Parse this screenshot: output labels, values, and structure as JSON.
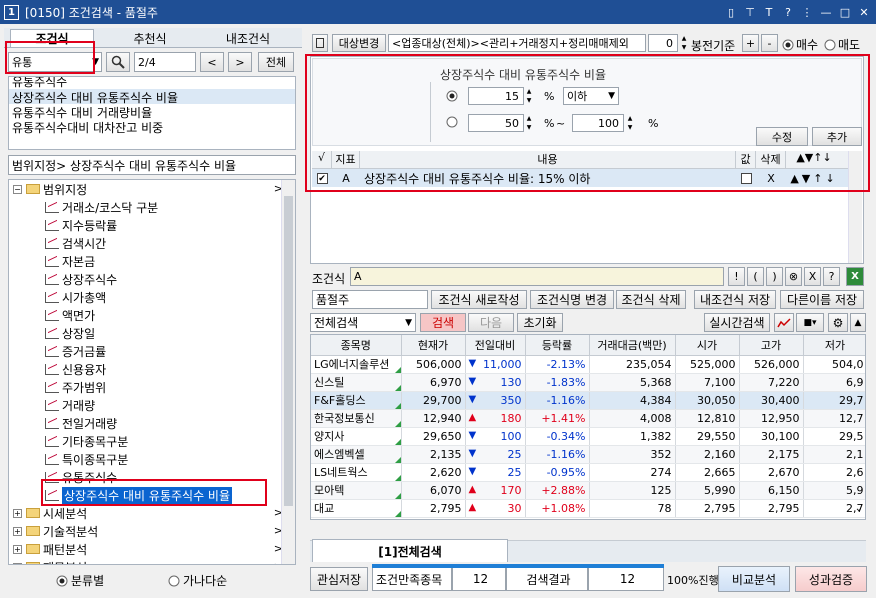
{
  "window": {
    "number_badge": "1",
    "title": "[0150] 조건검색 - 품절주",
    "controls": [
      "▯",
      "⊤",
      "T",
      "?",
      "⋮",
      "—",
      "□",
      "✕"
    ]
  },
  "left": {
    "tabs": [
      "조건식",
      "추천식",
      "내조건식"
    ],
    "search": {
      "value": "유통",
      "page": "2/4",
      "all_label": "전체"
    },
    "results": [
      "유통주식수",
      "상장주식수 대비 유통주식수 비율",
      "유통주식수 대비 거래량비율",
      "유통주식수대비 대차잔고 비중"
    ],
    "path": "범위지정> 상장주식수 대비 유통주식수 비율",
    "tree_root": "범위지정",
    "tree_items": [
      "거래소/코스닥 구분",
      "지수등락률",
      "검색시간",
      "자본금",
      "상장주식수",
      "시가총액",
      "액면가",
      "상장일",
      "증거금률",
      "신용융자",
      "주가범위",
      "거래량",
      "전일거래량",
      "기타종목구분",
      "특이종목구분",
      "유통주식수",
      "상장주식수 대비 유통주식수 비율"
    ],
    "tree_folders": [
      "시세분석",
      "기술적분석",
      "패턴분석",
      "재무분석"
    ],
    "radio_category": "분류별",
    "radio_alpha": "가나다순"
  },
  "top_bar": {
    "target_change": "대상변경",
    "target_value": "<업종대상(전체)><관리+거래정지+정리매매제외",
    "bar_count": "0",
    "bar_label": "봉전기준",
    "plus": "+",
    "minus": "-",
    "buy": "매수",
    "sell": "매도"
  },
  "condition_editor": {
    "title": "상장주식수 대비 유통주식수 비율",
    "opt1": {
      "value": "15",
      "unit": "%",
      "compare": "이하"
    },
    "opt2": {
      "from": "50",
      "unit1": "%",
      "tilde": "~",
      "to": "100",
      "unit2": "%"
    },
    "modify": "수정",
    "add": "추가"
  },
  "cond_list": {
    "headers": [
      "√",
      "지표",
      "내용",
      "값",
      "삭제",
      "▲▼↑↓"
    ],
    "rows": [
      {
        "tag": "A",
        "content": "상장주식수 대비 유통주식수 비율: 15% 이하",
        "delete": "X",
        "arrows": "▲▼↑↓"
      }
    ]
  },
  "formula": {
    "label": "조건식",
    "value": "A",
    "ops": [
      "!",
      "(",
      ")",
      "⊗",
      "X",
      "?"
    ]
  },
  "save_row": {
    "name": "품절주",
    "new": "조건식 새로작성",
    "rename": "조건식명 변경",
    "delete": "조건식 삭제",
    "my_save": "내조건식 저장",
    "save_as": "다른이름 저장"
  },
  "search_bar": {
    "mode": "전체검색",
    "search": "검색",
    "next": "다음",
    "reset": "초기화",
    "realtime": "실시간검색"
  },
  "stock_table": {
    "headers": [
      "종목명",
      "현재가",
      "전일대비",
      "등락률",
      "거래대금(백만)",
      "시가",
      "고가",
      "저가"
    ],
    "rows": [
      {
        "name": "LG에너지솔루션",
        "price": "506,000",
        "dir": "dn",
        "change": "11,000",
        "rate": "-2.13%",
        "amount": "235,054",
        "open": "525,000",
        "high": "526,000",
        "low": "504,0"
      },
      {
        "name": "신스틸",
        "price": "6,970",
        "dir": "dn",
        "change": "130",
        "rate": "-1.83%",
        "amount": "5,368",
        "open": "7,100",
        "high": "7,220",
        "low": "6,9"
      },
      {
        "name": "F&F홀딩스",
        "price": "29,700",
        "dir": "dn",
        "change": "350",
        "rate": "-1.16%",
        "amount": "4,384",
        "open": "30,050",
        "high": "30,400",
        "low": "29,7"
      },
      {
        "name": "한국정보통신",
        "price": "12,940",
        "dir": "up",
        "change": "180",
        "rate": "+1.41%",
        "amount": "4,008",
        "open": "12,810",
        "high": "12,950",
        "low": "12,7"
      },
      {
        "name": "양지사",
        "price": "29,650",
        "dir": "dn",
        "change": "100",
        "rate": "-0.34%",
        "amount": "1,382",
        "open": "29,550",
        "high": "30,100",
        "low": "29,5"
      },
      {
        "name": "에스엠벡셀",
        "price": "2,135",
        "dir": "dn",
        "change": "25",
        "rate": "-1.16%",
        "amount": "352",
        "open": "2,160",
        "high": "2,175",
        "low": "2,1"
      },
      {
        "name": "LS네트웍스",
        "price": "2,620",
        "dir": "dn",
        "change": "25",
        "rate": "-0.95%",
        "amount": "274",
        "open": "2,665",
        "high": "2,670",
        "low": "2,6"
      },
      {
        "name": "모아텍",
        "price": "6,070",
        "dir": "up",
        "change": "170",
        "rate": "+2.88%",
        "amount": "125",
        "open": "5,990",
        "high": "6,150",
        "low": "5,9"
      },
      {
        "name": "대교",
        "price": "2,795",
        "dir": "up",
        "change": "30",
        "rate": "+1.08%",
        "amount": "78",
        "open": "2,795",
        "high": "2,795",
        "low": "2,7"
      }
    ]
  },
  "bottom_tab": "[1]전체검색",
  "status": {
    "save": "관심저장",
    "match_label": "조건만족종목",
    "match": "12",
    "result_label": "검색결과",
    "result": "12",
    "progress": "100%진행",
    "compare": "비교분석",
    "perf": "성과검증",
    "progress_pct": 100
  },
  "colors": {
    "title_bar": "#1f4f95",
    "highlight": "#dbe8f5",
    "selected": "#0a64d0",
    "up": "#e0001b",
    "down": "#0033cc"
  }
}
